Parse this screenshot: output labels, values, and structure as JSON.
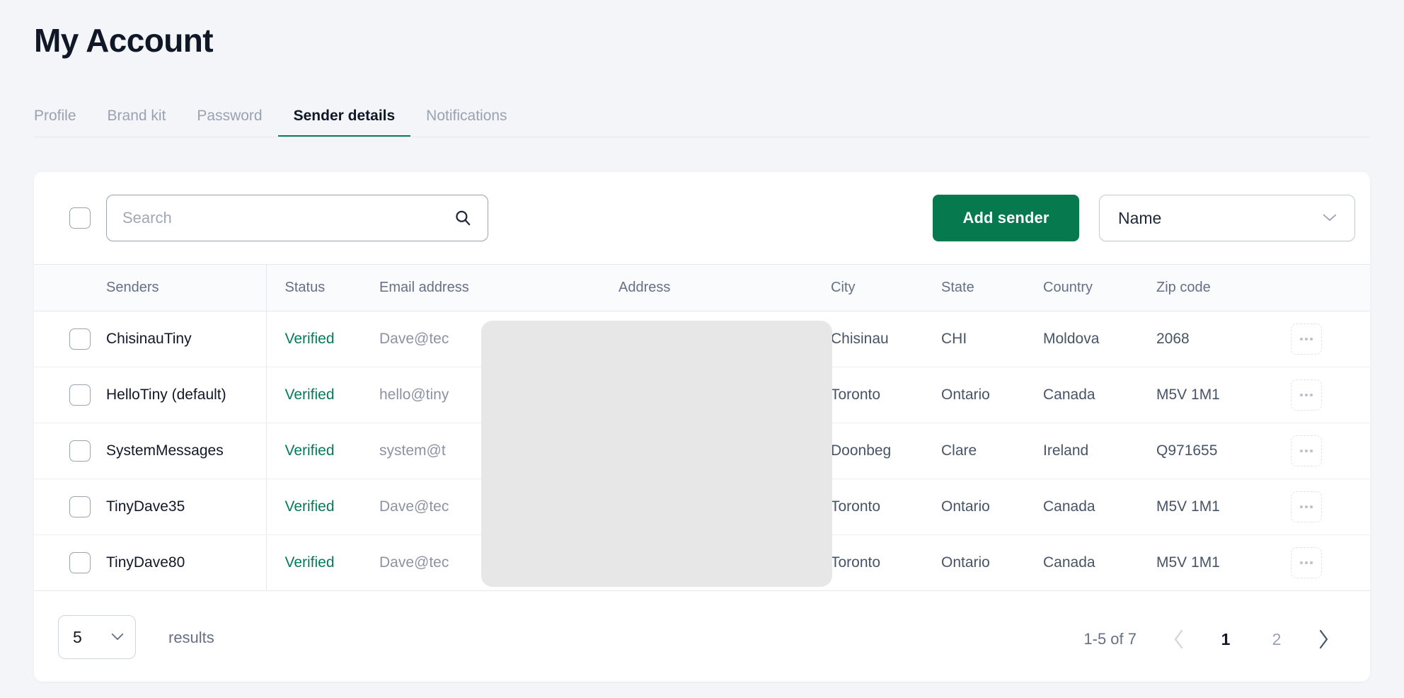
{
  "header": {
    "title": "My Account",
    "tabs": [
      {
        "label": "Profile",
        "active": false
      },
      {
        "label": "Brand kit",
        "active": false
      },
      {
        "label": "Password",
        "active": false
      },
      {
        "label": "Sender details",
        "active": true
      },
      {
        "label": "Notifications",
        "active": false
      }
    ]
  },
  "toolbar": {
    "search_placeholder": "Search",
    "search_value": "",
    "search_icon": "search-icon",
    "add_sender_label": "Add sender",
    "sort_select_value": "Name",
    "sort_chevron_icon": "chevron-down-icon"
  },
  "table": {
    "columns": [
      {
        "key": "check",
        "label": ""
      },
      {
        "key": "sender",
        "label": "Senders"
      },
      {
        "key": "status",
        "label": "Status"
      },
      {
        "key": "email",
        "label": "Email address"
      },
      {
        "key": "address",
        "label": "Address"
      },
      {
        "key": "city",
        "label": "City"
      },
      {
        "key": "state",
        "label": "State"
      },
      {
        "key": "country",
        "label": "Country"
      },
      {
        "key": "zip",
        "label": "Zip code"
      },
      {
        "key": "action",
        "label": ""
      }
    ],
    "rows": [
      {
        "sender": "ChisinauTiny",
        "status": "Verified",
        "email": "Dave@tec",
        "address": "",
        "city": "Chisinau",
        "state": "CHI",
        "country": "Moldova",
        "zip": "2068",
        "menu_icon": "ellipsis-icon"
      },
      {
        "sender": "HelloTiny (default)",
        "status": "Verified",
        "email": "hello@tiny",
        "address": "",
        "city": "Toronto",
        "state": "Ontario",
        "country": "Canada",
        "zip": "M5V 1M1",
        "menu_icon": "ellipsis-icon"
      },
      {
        "sender": "SystemMessages",
        "status": "Verified",
        "email": "system@t",
        "address": "",
        "city": "Doonbeg",
        "state": "Clare",
        "country": "Ireland",
        "zip": "Q971655",
        "menu_icon": "ellipsis-icon"
      },
      {
        "sender": "TinyDave35",
        "status": "Verified",
        "email": "Dave@tec",
        "address": "",
        "city": "Toronto",
        "state": "Ontario",
        "country": "Canada",
        "zip": "M5V 1M1",
        "menu_icon": "ellipsis-icon"
      },
      {
        "sender": "TinyDave80",
        "status": "Verified",
        "email": "Dave@tec",
        "address": "",
        "city": "Toronto",
        "state": "Ontario",
        "country": "Canada",
        "zip": "M5V 1M1",
        "menu_icon": "ellipsis-icon"
      }
    ]
  },
  "footer": {
    "per_page_value": "5",
    "per_page_chevron_icon": "chevron-down-icon",
    "results_label": "results",
    "range_label": "1-5 of 7",
    "prev_icon": "chevron-left-icon",
    "next_icon": "chevron-right-icon",
    "pages": [
      {
        "label": "1",
        "active": true
      },
      {
        "label": "2",
        "active": false
      }
    ]
  },
  "colors": {
    "accent_green": "#07794f",
    "verified_green": "#06795b",
    "page_bg": "#f4f5f9",
    "card_bg": "#ffffff",
    "title": "#101828",
    "muted_text": "#667085",
    "redaction": "#e7e7e7"
  }
}
